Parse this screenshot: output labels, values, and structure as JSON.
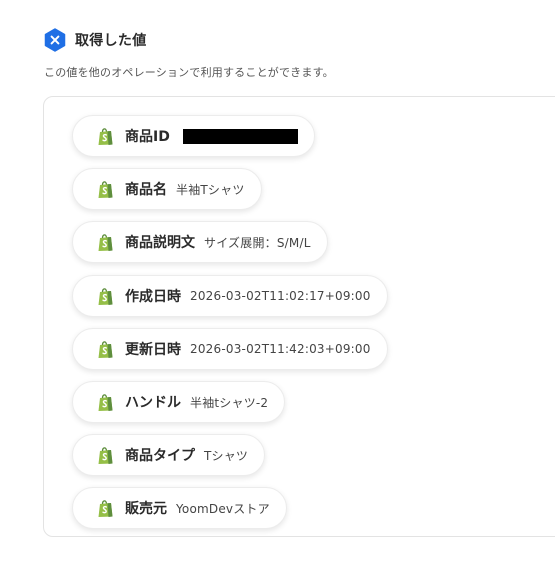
{
  "header": {
    "title": "取得した値",
    "subtitle": "この値を他のオペレーションで利用することができます。",
    "badge_icon": "x-hexagon-icon",
    "accent_color": "#1f6fe5"
  },
  "fields": [
    {
      "label": "商品ID",
      "value": "",
      "redacted": true
    },
    {
      "label": "商品名",
      "value": "半袖Tシャツ"
    },
    {
      "label": "商品説明文",
      "value": "サイズ展開：S/M/L"
    },
    {
      "label": "作成日時",
      "value": "2026-03-02T11:02:17+09:00"
    },
    {
      "label": "更新日時",
      "value": "2026-03-02T11:42:03+09:00"
    },
    {
      "label": "ハンドル",
      "value": "半袖tシャツ-2"
    },
    {
      "label": "商品タイプ",
      "value": "Tシャツ"
    },
    {
      "label": "販売元",
      "value": "YoomDevストア"
    }
  ],
  "field_icon": "shopify-bag-icon",
  "icon_colors": {
    "primary": "#95bf47",
    "dark": "#5e8e3e"
  }
}
